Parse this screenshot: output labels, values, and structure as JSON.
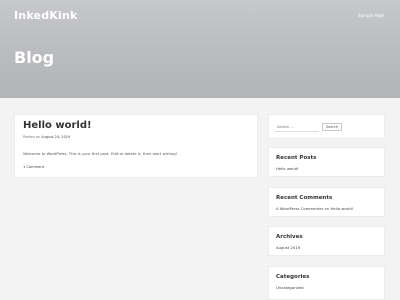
{
  "header": {
    "site_title": "InkedKink",
    "nav_link": "Sample Page",
    "page_title": "Blog"
  },
  "post": {
    "title": "Hello world!",
    "posted_on": "Posted on",
    "date": "August 24, 2019",
    "excerpt": "Welcome to WordPress. This is your first post. Edit or delete it, then start writing!",
    "comments": "1 Comment"
  },
  "sidebar": {
    "search": {
      "placeholder": "Search …",
      "button": "Search"
    },
    "recent_posts": {
      "title": "Recent Posts",
      "items": [
        "Hello world!"
      ]
    },
    "recent_comments": {
      "title": "Recent Comments",
      "author": "A WordPress Commenter",
      "on": "on",
      "post": "Hello world!"
    },
    "archives": {
      "title": "Archives",
      "items": [
        "August 2019"
      ]
    },
    "categories": {
      "title": "Categories",
      "items": [
        "Uncategorized"
      ]
    }
  }
}
